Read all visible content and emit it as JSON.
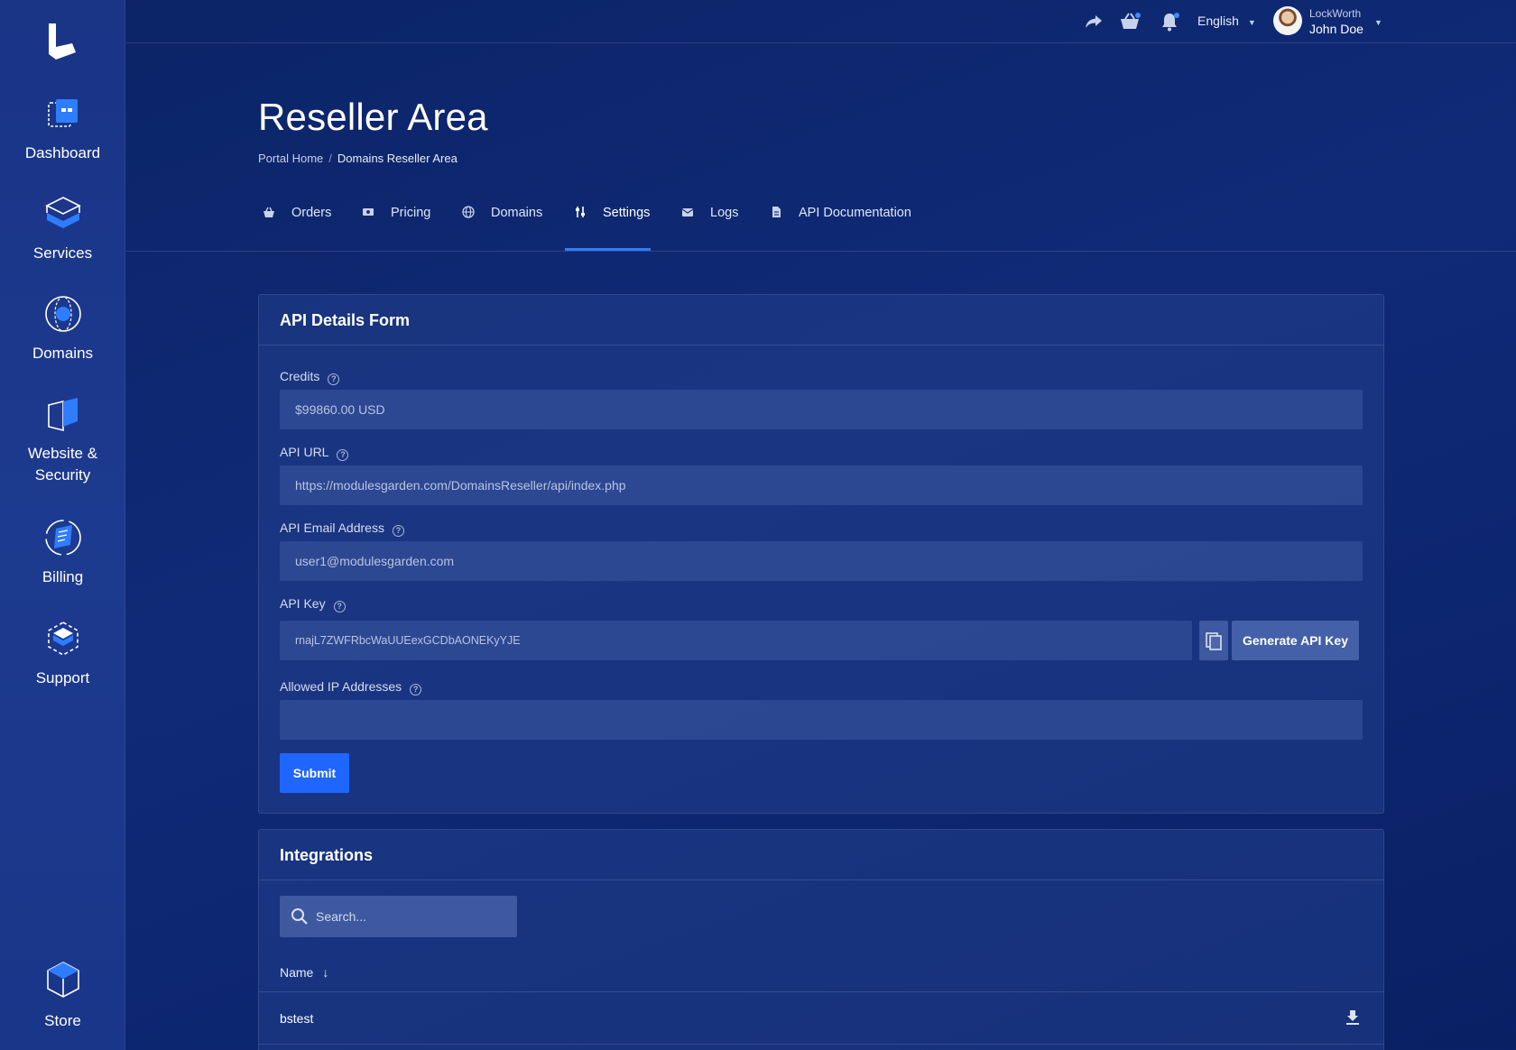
{
  "sidebar": {
    "items": [
      {
        "label": "Dashboard",
        "icon": "dashboard-icon"
      },
      {
        "label": "Services",
        "icon": "services-icon"
      },
      {
        "label": "Domains",
        "icon": "domains-icon"
      },
      {
        "label": "Website & Security",
        "icon": "website-security-icon"
      },
      {
        "label": "Billing",
        "icon": "billing-icon"
      },
      {
        "label": "Support",
        "icon": "support-icon"
      }
    ],
    "store": {
      "label": "Store",
      "icon": "store-icon"
    }
  },
  "topbar": {
    "language": "English",
    "company": "LockWorth",
    "user_name": "John Doe"
  },
  "header": {
    "title": "Reseller Area",
    "breadcrumb": [
      "Portal Home",
      "Domains Reseller Area"
    ]
  },
  "tabs": [
    {
      "label": "Orders",
      "icon": "basket-icon"
    },
    {
      "label": "Pricing",
      "icon": "money-icon"
    },
    {
      "label": "Domains",
      "icon": "globe-icon"
    },
    {
      "label": "Settings",
      "icon": "sliders-icon",
      "active": true
    },
    {
      "label": "Logs",
      "icon": "mail-icon"
    },
    {
      "label": "API Documentation",
      "icon": "document-icon"
    }
  ],
  "api_form": {
    "title": "API Details Form",
    "credits_label": "Credits",
    "credits_value": "$99860.00 USD",
    "api_url_label": "API URL",
    "api_url_value": "https://modulesgarden.com/DomainsReseller/api/index.php",
    "email_label": "API Email Address",
    "email_value": "user1@modulesgarden.com",
    "key_label": "API Key",
    "key_value": "rnajL7ZWFRbcWaUUEexGCDbAONEKyYJE",
    "generate_label": "Generate API Key",
    "ip_label": "Allowed IP Addresses",
    "ip_value": "",
    "submit_label": "Submit"
  },
  "integrations": {
    "title": "Integrations",
    "search_placeholder": "Search...",
    "column_name": "Name",
    "sort_arrow": "↓",
    "rows": [
      {
        "name": "bstest"
      }
    ]
  },
  "colors": {
    "accent": "#1f66ff",
    "tab_underline": "#2f7dff",
    "background": "#0d2670"
  }
}
